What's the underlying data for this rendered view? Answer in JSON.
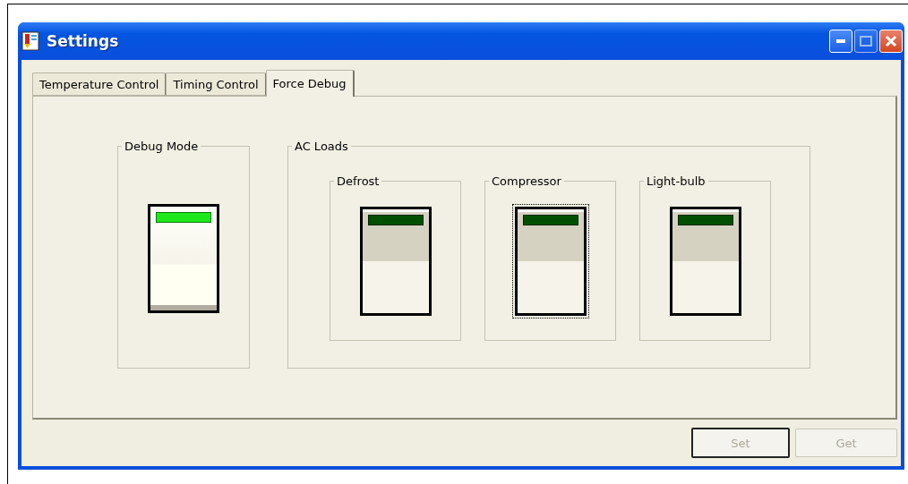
{
  "window": {
    "title": "Settings"
  },
  "tabs": [
    {
      "label": "Temperature Control",
      "selected": false
    },
    {
      "label": "Timing Control",
      "selected": false
    },
    {
      "label": "Force Debug",
      "selected": true
    }
  ],
  "debug_mode": {
    "title": "Debug Mode",
    "switch": {
      "on": true,
      "focused": false
    }
  },
  "ac_loads": {
    "title": "AC Loads",
    "loads": [
      {
        "name": "Defrost",
        "on": false,
        "focused": false
      },
      {
        "name": "Compressor",
        "on": false,
        "focused": true
      },
      {
        "name": "Light-bulb",
        "on": false,
        "focused": false
      }
    ]
  },
  "buttons": [
    {
      "label": "Set",
      "disabled": true,
      "default": true
    },
    {
      "label": "Get",
      "disabled": true,
      "default": false
    }
  ]
}
